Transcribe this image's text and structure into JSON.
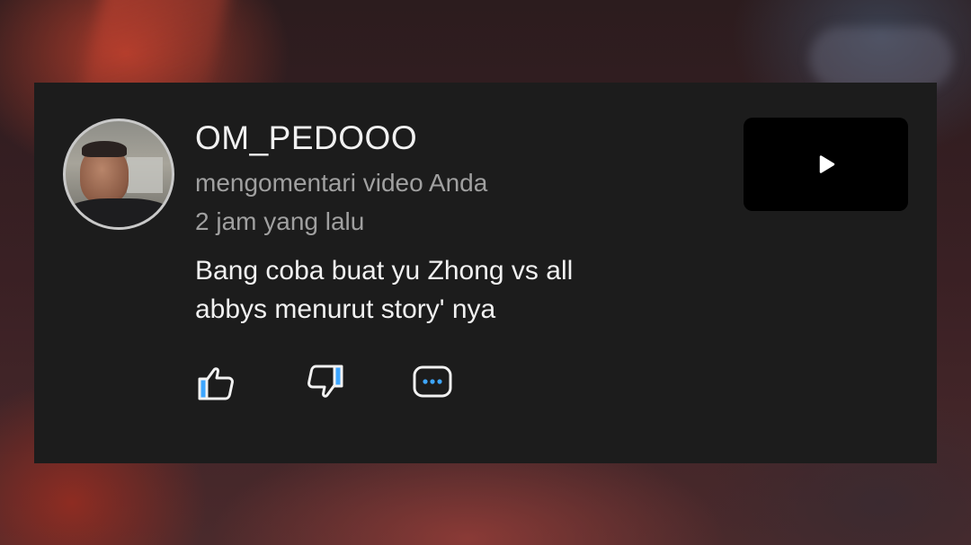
{
  "notification": {
    "username": "OM_PEDOOO",
    "action_text": "mengomentari video Anda",
    "time_ago": "2 jam yang lalu",
    "comment_lines": [
      "Bang coba buat yu Zhong vs all",
      "abbys menurut story' nya"
    ]
  },
  "icons": {
    "avatar": "user-avatar",
    "thumbnail": "play-icon",
    "like": "thumbs-up-icon",
    "dislike": "thumbs-down-icon",
    "reply": "comment-icon"
  },
  "colors": {
    "card_bg": "#1c1c1c",
    "primary_text": "#f1f1f1",
    "secondary_text": "#a0a0a0",
    "icon_outline": "#f1f1f1",
    "icon_accent": "#3ea6ff"
  }
}
